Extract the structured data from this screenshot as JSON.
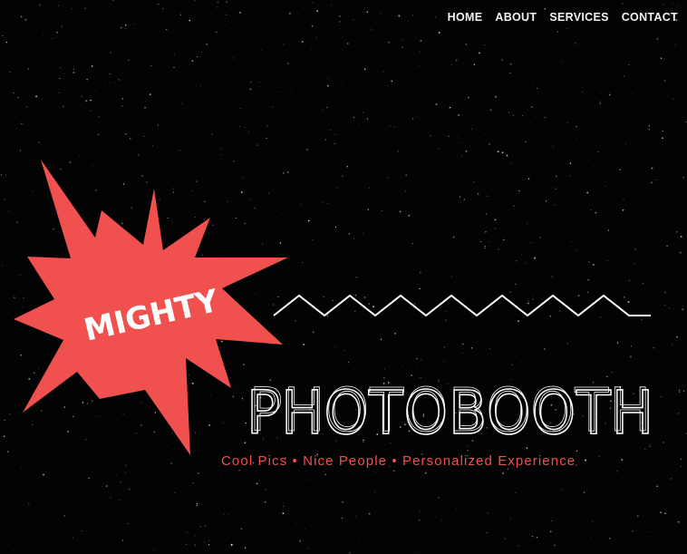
{
  "nav": {
    "items": [
      {
        "label": "HOME"
      },
      {
        "label": "ABOUT"
      },
      {
        "label": "SERVICES"
      },
      {
        "label": "CONTACT"
      }
    ]
  },
  "logo": {
    "word_top": "MIGHTY",
    "word_main": "PHOTOBOOTH"
  },
  "tagline": "Cool Pics • Nice People • Personalized Experience",
  "colors": {
    "background": "#030303",
    "accent": "#f0504e",
    "text": "#ffffff"
  }
}
